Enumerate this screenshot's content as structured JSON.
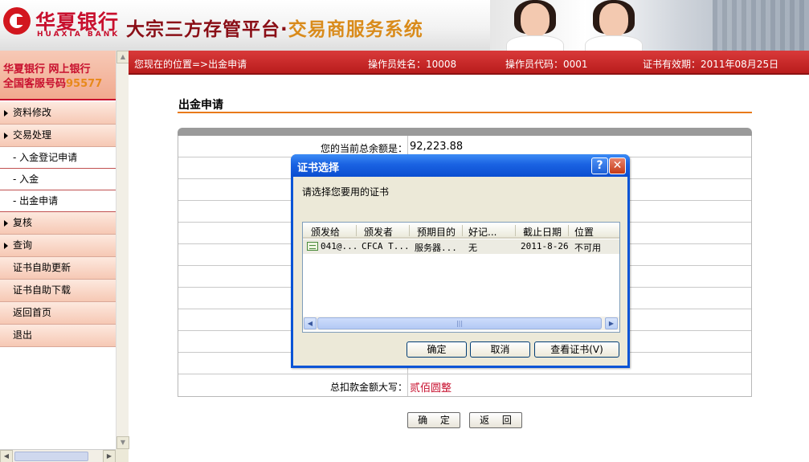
{
  "banner": {
    "bank_name": "华夏银行",
    "bank_name_en": "HUAXIA BANK",
    "platform": "大宗三方存管平台",
    "platform_dot": "·",
    "platform_sub": "交易商服务系统"
  },
  "sidebar": {
    "promo_line1": "华夏银行 网上银行",
    "promo_line2_prefix": "全国客服号码",
    "promo_line2_number": "95577",
    "items": [
      {
        "label": "资料修改",
        "type": "group"
      },
      {
        "label": "交易处理",
        "type": "group"
      },
      {
        "label": "- 入金登记申请",
        "type": "sub"
      },
      {
        "label": "- 入金",
        "type": "sub"
      },
      {
        "label": "- 出金申请",
        "type": "sub"
      },
      {
        "label": "复核",
        "type": "group"
      },
      {
        "label": "查询",
        "type": "group"
      },
      {
        "label": "证书自助更新",
        "type": "link"
      },
      {
        "label": "证书自助下载",
        "type": "link"
      },
      {
        "label": "返回首页",
        "type": "link"
      },
      {
        "label": "退出",
        "type": "link"
      }
    ]
  },
  "locbar": {
    "location": "您现在的位置=>出金申请",
    "operator_name": "操作员姓名：10008",
    "operator_code": "操作员代码：0001",
    "cert_expiry": "证书有效期：2011年08月25日"
  },
  "main": {
    "title": "出金申请",
    "balance_label": "您的当前总余额是：",
    "balance_value": "92,223.88",
    "amount_caps_label": "总扣款金额大写：",
    "amount_caps_value": "贰佰圆整",
    "ok_label": "确 定",
    "back_label": "返 回"
  },
  "dialog": {
    "title": "证书选择",
    "help": "?",
    "close": "✕",
    "prompt": "请选择您要用的证书",
    "columns": [
      "颁发给",
      "颁发者",
      "预期目的",
      "好记...",
      "截止日期",
      "位置"
    ],
    "row": [
      "041@...",
      "CFCA T...",
      "服务器...",
      "无",
      "2011-8-26",
      "不可用"
    ],
    "ok": "确定",
    "cancel": "取消",
    "view": "查看证书(V)"
  },
  "colors": {
    "brand_red": "#c8102e",
    "title_rule": "#e87a1a",
    "xp_blue": "#0a54d6",
    "caps_amount": "#c8102e"
  }
}
